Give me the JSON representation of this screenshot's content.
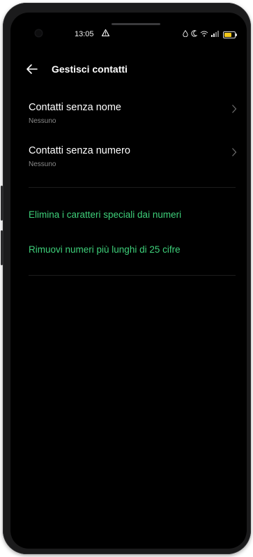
{
  "status_bar": {
    "time": "13:05",
    "alert_icon": "warning-icon",
    "right_icons": [
      "drop-icon",
      "moon-icon",
      "wifi-icon",
      "signal-icon",
      "battery-icon"
    ],
    "battery_level": 0.8,
    "battery_color": "#f2c81a"
  },
  "header": {
    "back_icon": "arrow-left-icon",
    "title": "Gestisci contatti"
  },
  "items": [
    {
      "title": "Contatti senza nome",
      "subtitle": "Nessuno"
    },
    {
      "title": "Contatti senza numero",
      "subtitle": "Nessuno"
    }
  ],
  "actions": [
    "Elimina i caratteri speciali dai numeri",
    "Rimuovi numeri più lunghi di 25 cifre"
  ],
  "colors": {
    "background": "#000000",
    "accent": "#3ed07a",
    "subtitle": "#8a8a8a"
  }
}
